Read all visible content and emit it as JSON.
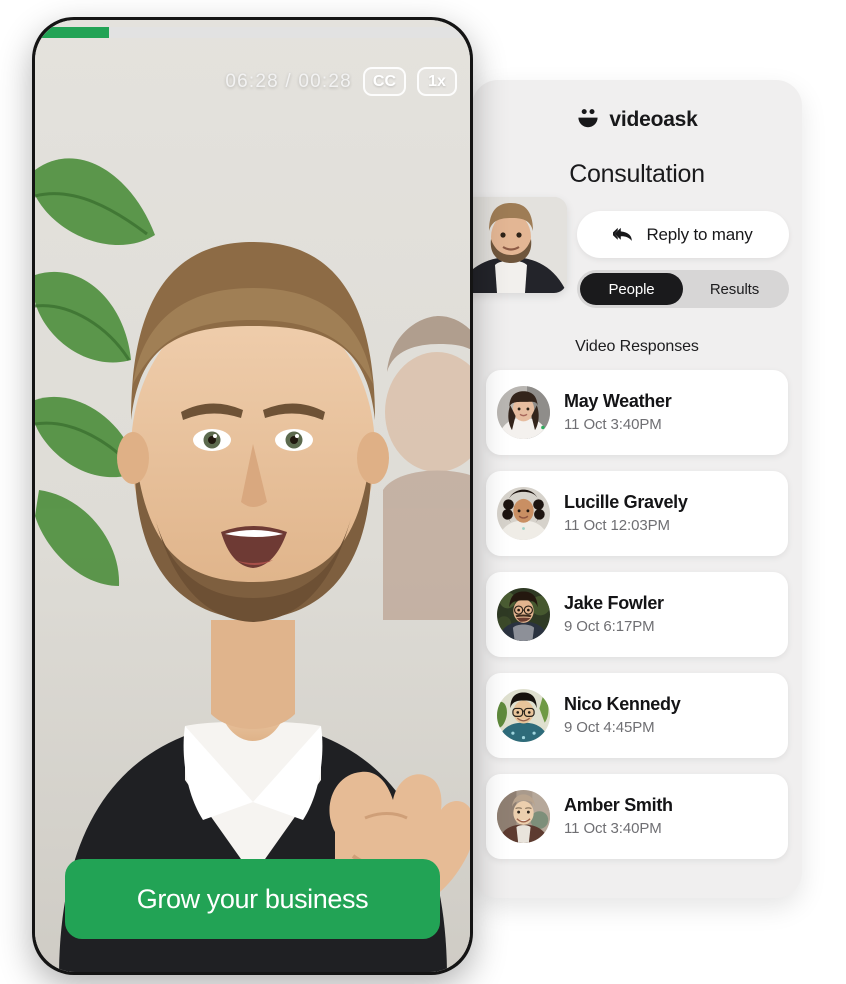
{
  "brand": {
    "name": "videoask",
    "logo_icon": "videoask-smiley-icon"
  },
  "panel": {
    "title": "Consultation",
    "reply_button": {
      "label": "Reply to many",
      "icon": "reply-all-icon"
    },
    "tabs": [
      {
        "label": "People",
        "active": true
      },
      {
        "label": "Results",
        "active": false
      }
    ],
    "section_label": "Video Responses",
    "responses": [
      {
        "name": "May Weather",
        "time": "11 Oct 3:40PM"
      },
      {
        "name": "Lucille Gravely",
        "time": "11 Oct 12:03PM"
      },
      {
        "name": "Jake Fowler",
        "time": "9 Oct 6:17PM"
      },
      {
        "name": "Nico Kennedy",
        "time": "9 Oct 4:45PM"
      },
      {
        "name": "Amber Smith",
        "time": "11 Oct 3:40PM"
      }
    ]
  },
  "phone": {
    "progress_percent": 17,
    "timecode": "06:28 / 00:28",
    "captions_button": "CC",
    "speed_button": "1x",
    "cta_label": "Grow your business"
  },
  "colors": {
    "accent_green": "#22a355",
    "panel_bg": "#f0efef",
    "card_bg": "#ffffff",
    "tab_active_bg": "#1a1a1c",
    "tab_track_bg": "#d7d6d6",
    "phone_frame": "#141414",
    "muted_text": "#6f6f73"
  }
}
